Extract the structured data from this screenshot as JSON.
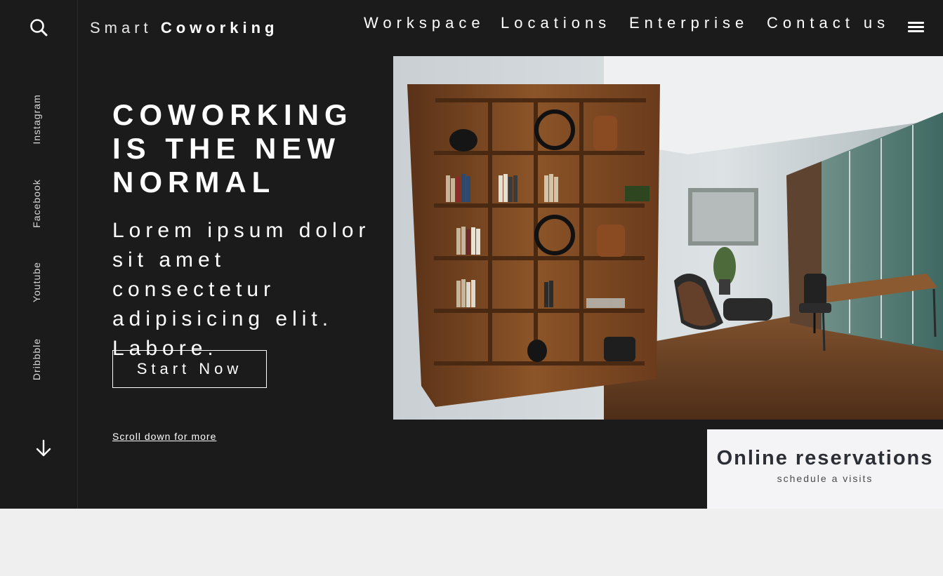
{
  "brand": {
    "light": "Smart",
    "bold": "Coworking"
  },
  "nav": [
    {
      "label": "Workspace"
    },
    {
      "label": "Locations"
    },
    {
      "label": "Enterprise"
    },
    {
      "label": "Contact us"
    }
  ],
  "social": [
    {
      "label": "Instagram"
    },
    {
      "label": "Facebook"
    },
    {
      "label": "Youtube"
    },
    {
      "label": "Dribbble"
    }
  ],
  "hero": {
    "headline": "COWORKING IS THE NEW NORMAL",
    "lead": "Lorem ipsum dolor sit amet consectetur adipisicing elit. Labore.",
    "cta": "Start Now",
    "scroll": "Scroll down for more"
  },
  "reservation": {
    "title": "Online reservations",
    "subtitle": "schedule a visits"
  },
  "icons": {
    "search": "search-icon",
    "menu": "hamburger-menu-icon",
    "scroll": "arrow-down-icon"
  },
  "colors": {
    "background_dark": "#1b1b1b",
    "page_light": "#efefef",
    "card": "#f4f4f6",
    "card_text": "#2d2f36",
    "text": "#ffffff"
  }
}
